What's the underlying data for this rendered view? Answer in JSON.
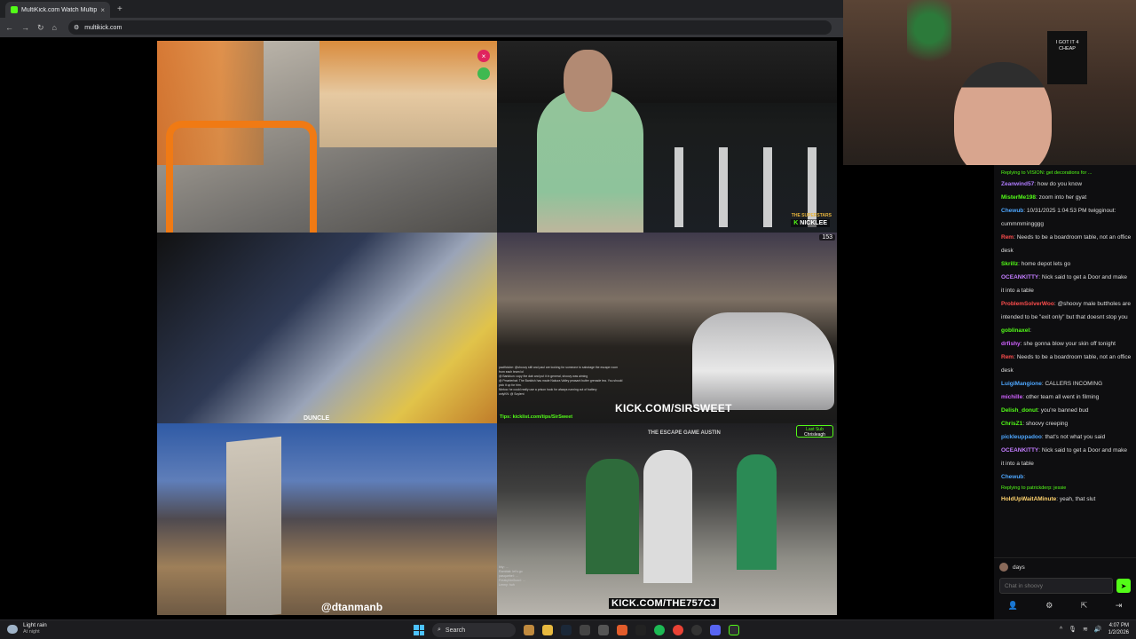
{
  "browser": {
    "tab_title": "MultiKick.com Watch Multiple",
    "tab_close": "×",
    "new_tab": "+",
    "url": "multikick.com"
  },
  "streams": {
    "s1": {
      "close_icon": "×"
    },
    "s2": {
      "name": "NICKLEE",
      "badge": "THE SUPERSTARS"
    },
    "s3": {
      "name": "DUNCLE"
    },
    "s4": {
      "viewers": "153",
      "kick_url": "KICK.COM/SIRSWEET",
      "tips": "Tips: kicklist.com/tips/SirSweet",
      "chat_lines": [
        "pacificlube: @shoovy still and paul are looking for someone to sabotage the escape room from each team lol",
        "@ Bankkun: copy the dab and put it in general, shoovy was aiming",
        "@ Pmarterbal: The Bankish has made Nakura Valley peasant butter grenade tea. You should pick it up for him.",
        "Nintoa: he could really use a prison hook for always running out of battery",
        "onlyKN: @ Soylent"
      ]
    },
    "s5": {
      "name": "@dtanmanb"
    },
    "s6": {
      "kick_url": "KICK.COM/THE757CJ",
      "last_sub_label": "Last Sub",
      "last_sub_name": "Chrisleagh",
      "venue": "THE ESCAPE GAME AUSTIN",
      "chat_lines": [
        "tirly: ...",
        "Rambiat: let's go",
        "pasquebel: ...",
        "FreakyNoGucci: ...",
        "Lenny: huh"
      ]
    }
  },
  "cam": {
    "shirt_text": "I GOT IT 4 CHEAP"
  },
  "chat": {
    "messages": [
      {
        "reply_to": "Replying to VISION: get decorations for ...",
        "user": "Zeanwind57",
        "color": "#b07cff",
        "text": "how do you know"
      },
      {
        "user": "MisterMe198",
        "color": "#53fc18",
        "text": "zoom into her gyat"
      },
      {
        "user": "Chewub",
        "color": "#4ea7ff",
        "text": "10/31/2025 1:04:53 PM twigginout: cummmmingggg"
      },
      {
        "user": "Rem",
        "color": "#ff4d4d",
        "text": "Needs to be a boardroom table, not an office desk"
      },
      {
        "user": "Skrillz",
        "color": "#53fc18",
        "text": "home depot lets go"
      },
      {
        "user": "OCEANKITTY",
        "color": "#c37dff",
        "text": "Nick said to get a Door and make it into a table"
      },
      {
        "user": "ProblemSolverWoo",
        "color": "#ff4d4d",
        "text": "@shoovy male buttholes are intended to be \"exit only\" but that doesnt stop you"
      },
      {
        "user": "goblinaxel",
        "color": "#53fc18",
        "text": ""
      },
      {
        "user": "drfishy",
        "color": "#d061ff",
        "text": "she gonna blow your skin off tonight"
      },
      {
        "user": "Rem",
        "color": "#ff4d4d",
        "text": "Needs to be a boardroom table, not an office desk"
      },
      {
        "user": "LuigiMangione",
        "color": "#4ea7ff",
        "text": "CALLERS INCOMING"
      },
      {
        "user": "michille",
        "color": "#d061ff",
        "text": "other team all went in filming"
      },
      {
        "user": "Delish_donut",
        "color": "#53fc18",
        "text": "you're banned bud"
      },
      {
        "user": "ChrisZ1",
        "color": "#53fc18",
        "text": "shoovy creeping"
      },
      {
        "user": "pickleuppadoo",
        "color": "#4ea7ff",
        "text": "that's not what you said"
      },
      {
        "user": "OCEANKITTY",
        "color": "#c37dff",
        "text": "Nick said to get a Door and make it into a table"
      },
      {
        "user": "Chewub",
        "color": "#4ea7ff",
        "text": ""
      },
      {
        "reply_to": "Replying to patrickderp: jessie",
        "user": "HoldUpWaitAMinute",
        "color": "#ffd36e",
        "text": "yeah, that slut"
      }
    ],
    "pinned_user": "days",
    "input_placeholder": "Chat in shoovy",
    "send_icon": "➤"
  },
  "taskbar": {
    "weather_title": "Light rain",
    "weather_sub": "At night",
    "search_placeholder": "Search",
    "time": "4:07 PM",
    "date": "1/2/2026"
  },
  "colors": {
    "kick_green": "#53fc18",
    "chat_bg": "#0e0e10"
  }
}
